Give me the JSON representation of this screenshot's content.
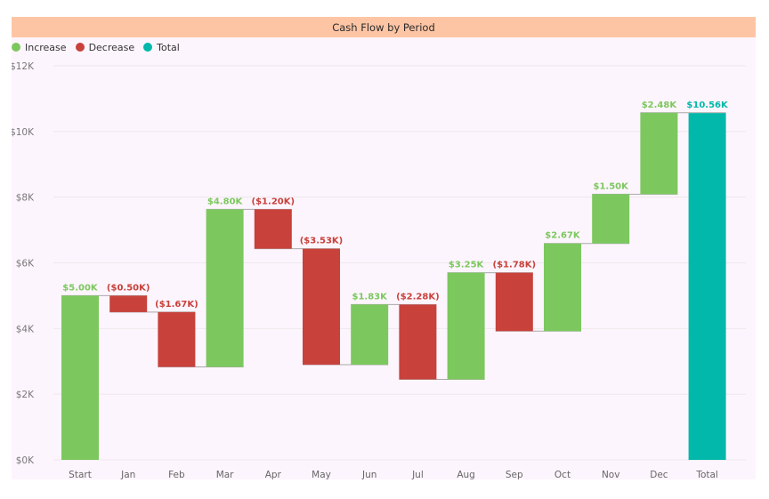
{
  "chart_data": {
    "type": "waterfall",
    "title": "Cash Flow by Period",
    "xlabel": "",
    "ylabel": "",
    "ylim": [
      0,
      12
    ],
    "y_unit": "K",
    "y_ticks": [
      0,
      2,
      4,
      6,
      8,
      10,
      12
    ],
    "y_tick_labels": [
      "$0K",
      "$2K",
      "$4K",
      "$6K",
      "$8K",
      "$10K",
      "$12K"
    ],
    "grid": true,
    "legend_position": "top-left",
    "legend": [
      {
        "label": "Increase",
        "color": "#7cc85e"
      },
      {
        "label": "Decrease",
        "color": "#c8413b"
      },
      {
        "label": "Total",
        "color": "#01b8aa"
      }
    ],
    "categories": [
      "Start",
      "Jan",
      "Feb",
      "Mar",
      "Apr",
      "May",
      "Jun",
      "Jul",
      "Aug",
      "Sep",
      "Oct",
      "Nov",
      "Dec",
      "Total"
    ],
    "values": [
      5.0,
      -0.5,
      -1.67,
      4.8,
      -1.2,
      -3.53,
      1.83,
      -2.28,
      3.25,
      -1.78,
      2.67,
      1.5,
      2.48,
      10.56
    ],
    "kinds": [
      "increase",
      "decrease",
      "decrease",
      "increase",
      "decrease",
      "decrease",
      "increase",
      "decrease",
      "increase",
      "decrease",
      "increase",
      "increase",
      "increase",
      "total"
    ],
    "data_labels": [
      "$5.00K",
      "($0.50K)",
      "($1.67K)",
      "$4.80K",
      "($1.20K)",
      "($3.53K)",
      "$1.83K",
      "($2.28K)",
      "$3.25K",
      "($1.78K)",
      "$2.67K",
      "$1.50K",
      "$2.48K",
      "$10.56K"
    ]
  },
  "colors": {
    "increase": "#7cc85e",
    "decrease": "#c8413b",
    "total": "#01b8aa",
    "increase_label": "#7cc85e",
    "decrease_label": "#c8413b",
    "total_label": "#01b8aa",
    "connector": "#a9a9a9",
    "grid": "#ece8ec"
  }
}
